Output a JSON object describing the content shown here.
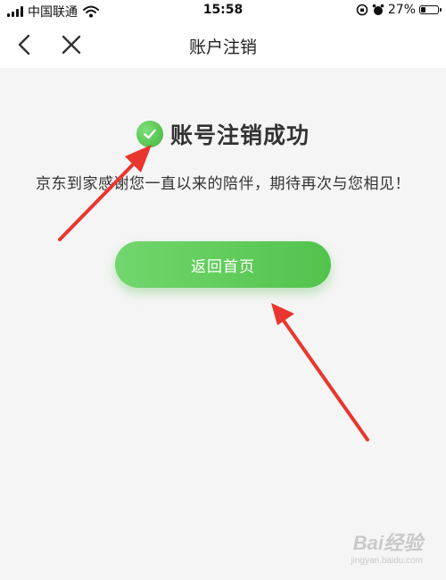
{
  "status_bar": {
    "carrier": "中国联通",
    "time": "15:58",
    "battery": "27%",
    "battery_level": 0.27,
    "icons": [
      "signal-icon",
      "wifi-icon",
      "screen-lock-icon",
      "alarm-icon",
      "battery-icon"
    ]
  },
  "nav": {
    "title": "账户注销",
    "back_icon": "chevron-left-icon",
    "close_icon": "close-icon"
  },
  "main": {
    "success_icon": "check-circle-icon",
    "success_title": "账号注销成功",
    "thanks_text": "京东到家感谢您一直以来的陪伴，期待再次与您相见！",
    "home_button_label": "返回首页"
  },
  "colors": {
    "accent_green": "#52c34c",
    "background": "#f5f5f5",
    "annotation_red": "#e8362e"
  },
  "watermark": {
    "brand": "Bai经验",
    "url": "jingyan.baidu.com"
  }
}
